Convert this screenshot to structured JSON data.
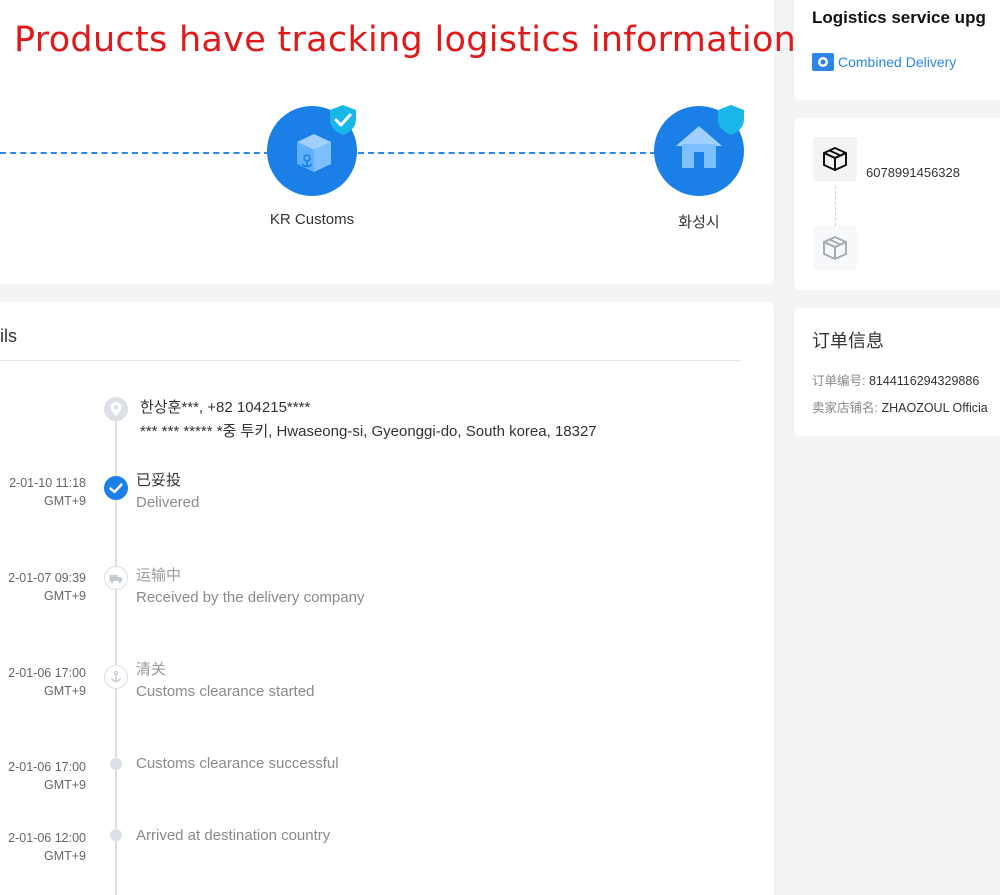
{
  "banner": {
    "text": "Products have tracking logistics information"
  },
  "route": {
    "stops": [
      {
        "label": "KR Customs",
        "icon": "customs-box-icon"
      },
      {
        "label": "화성시",
        "icon": "house-icon"
      }
    ]
  },
  "details": {
    "title": "ils",
    "address": {
      "line1": "한상훈***,  +82 104215****",
      "line2": "*** *** ***** *중 투키,  Hwaseong-si,  Gyeonggi-do,  South korea,  18327"
    },
    "events": [
      {
        "time": "2-01-10 11:18",
        "tz": "GMT+9",
        "status": "已妥投",
        "desc": "Delivered"
      },
      {
        "time": "2-01-07 09:39",
        "tz": "GMT+9",
        "status": "运输中",
        "desc": "Received by the delivery company"
      },
      {
        "time": "2-01-06 17:00",
        "tz": "GMT+9",
        "status": "清关",
        "desc": "Customs clearance started"
      },
      {
        "time": "2-01-06 17:00",
        "tz": "GMT+9",
        "status": "",
        "desc": "Customs clearance successful"
      },
      {
        "time": "2-01-06 12:00",
        "tz": "GMT+9",
        "status": "",
        "desc": "Arrived at destination country"
      }
    ]
  },
  "service": {
    "title": "Logistics service upg",
    "tag": "Combined Delivery"
  },
  "parcel": {
    "number": "6078991456328"
  },
  "order": {
    "title": "订单信息",
    "number_label": "订单编号:",
    "number": "8144116294329886",
    "store_label": "卖家店铺名:",
    "store": "ZHAOZOUL Officia"
  },
  "colors": {
    "accent": "#1a7fe6",
    "banner": "#e01a1a",
    "badge": "#19b7e8"
  }
}
